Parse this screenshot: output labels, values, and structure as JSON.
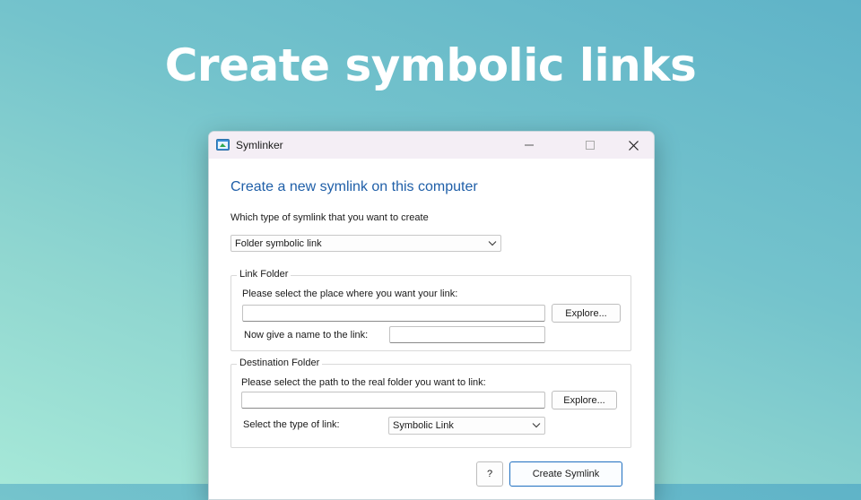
{
  "banner": {
    "headline": "Create symbolic links"
  },
  "window": {
    "title": "Symlinker",
    "controls": {
      "minimize": "minimize-icon",
      "maximize": "maximize-icon",
      "close": "close-icon"
    }
  },
  "form": {
    "heading": "Create a new symlink on this computer",
    "type_prompt": "Which type of symlink that you want to create",
    "type_selected": "Folder symbolic link",
    "link_folder": {
      "title": "Link Folder",
      "place_prompt": "Please select the place where you want your link:",
      "place_value": "",
      "explore_label": "Explore...",
      "name_prompt": "Now give a name to the link:",
      "name_value": ""
    },
    "destination_folder": {
      "title": "Destination Folder",
      "path_prompt": "Please select the path to the real folder you want to link:",
      "path_value": "",
      "explore_label": "Explore...",
      "link_type_prompt": "Select the type of link:",
      "link_type_selected": "Symbolic Link"
    },
    "help_label": "?",
    "create_label": "Create Symlink"
  },
  "colors": {
    "accent": "#1f5fa8",
    "primary_border": "#1f6fc0",
    "titlebar": "#f4eef5"
  }
}
